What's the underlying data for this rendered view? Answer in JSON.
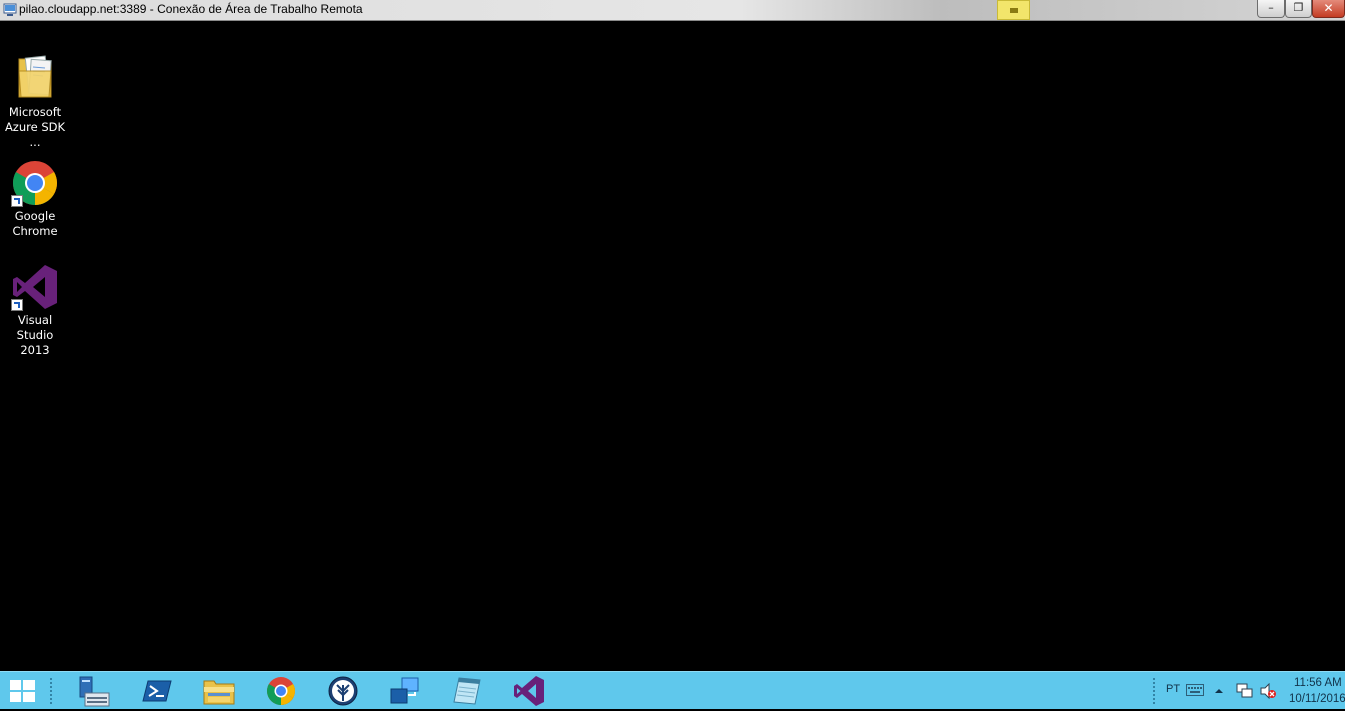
{
  "window": {
    "title": "pilao.cloudapp.net:3389 - Conexão de Área de Trabalho Remota",
    "ghost_text": "",
    "controls": {
      "minimize": "–",
      "restore": "❐",
      "close": "✕"
    }
  },
  "desktop": {
    "icons": [
      {
        "name": "azure-sdk-folder",
        "label_line1": "Microsoft",
        "label_line2": "Azure SDK ..."
      },
      {
        "name": "google-chrome",
        "label_line1": "Google",
        "label_line2": "Chrome"
      },
      {
        "name": "visual-studio-2013",
        "label_line1": "Visual Studio",
        "label_line2": "2013"
      }
    ]
  },
  "taskbar": {
    "pinned": [
      "start-windows-icon",
      "server-manager-icon",
      "powershell-icon",
      "file-explorer-icon",
      "chrome-icon",
      "sourcetree-icon",
      "remote-desktop-icon",
      "notepad-icon",
      "visual-studio-icon"
    ],
    "tray": {
      "language": "PT",
      "time": "11:56 AM",
      "date": "10/11/2016"
    }
  },
  "colors": {
    "taskbar": "#5fc8ec",
    "desktop": "#000000",
    "vs_purple": "#68217a"
  }
}
